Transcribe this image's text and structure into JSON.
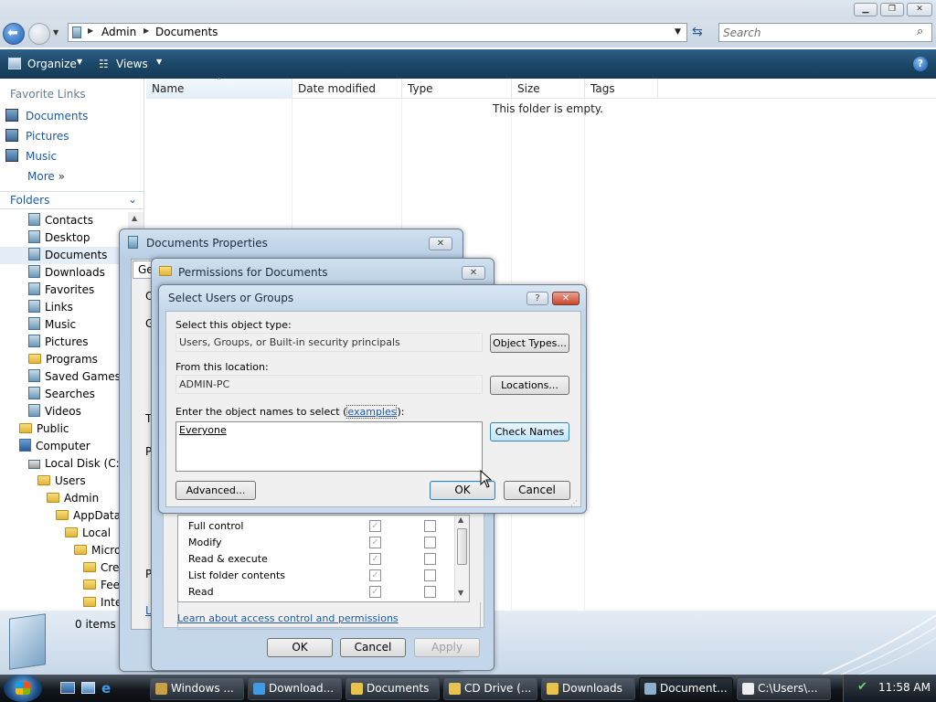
{
  "window": {
    "breadcrumb": [
      "Admin",
      "Documents"
    ],
    "search_placeholder": "Search",
    "caption_buttons": [
      "minimize",
      "maximize",
      "close"
    ]
  },
  "toolbar": {
    "organize": "Organize",
    "views": "Views"
  },
  "nav": {
    "favorite_links_header": "Favorite Links",
    "favorites": [
      "Documents",
      "Pictures",
      "Music"
    ],
    "more": "More",
    "folders_header": "Folders",
    "tree": [
      {
        "label": "Contacts",
        "depth": 2,
        "icon": "doc"
      },
      {
        "label": "Desktop",
        "depth": 2,
        "icon": "doc"
      },
      {
        "label": "Documents",
        "depth": 2,
        "icon": "doc",
        "selected": true
      },
      {
        "label": "Downloads",
        "depth": 2,
        "icon": "doc"
      },
      {
        "label": "Favorites",
        "depth": 2,
        "icon": "doc"
      },
      {
        "label": "Links",
        "depth": 2,
        "icon": "doc"
      },
      {
        "label": "Music",
        "depth": 2,
        "icon": "doc"
      },
      {
        "label": "Pictures",
        "depth": 2,
        "icon": "doc"
      },
      {
        "label": "Programs",
        "depth": 2,
        "icon": "folder"
      },
      {
        "label": "Saved Games",
        "depth": 2,
        "icon": "doc"
      },
      {
        "label": "Searches",
        "depth": 2,
        "icon": "doc"
      },
      {
        "label": "Videos",
        "depth": 2,
        "icon": "doc"
      },
      {
        "label": "Public",
        "depth": 1,
        "icon": "folder"
      },
      {
        "label": "Computer",
        "depth": 1,
        "icon": "computer"
      },
      {
        "label": "Local Disk (C:)",
        "depth": 2,
        "icon": "drive"
      },
      {
        "label": "Users",
        "depth": 3,
        "icon": "folder"
      },
      {
        "label": "Admin",
        "depth": 4,
        "icon": "folder"
      },
      {
        "label": "AppData",
        "depth": 5,
        "icon": "folder"
      },
      {
        "label": "Local",
        "depth": 6,
        "icon": "folder"
      },
      {
        "label": "Micro",
        "depth": 7,
        "icon": "folder"
      },
      {
        "label": "Cre",
        "depth": 8,
        "icon": "folder"
      },
      {
        "label": "Fee",
        "depth": 8,
        "icon": "folder"
      },
      {
        "label": "Inte",
        "depth": 8,
        "icon": "folder"
      }
    ]
  },
  "list": {
    "columns": [
      "Name",
      "Date modified",
      "Type",
      "Size",
      "Tags"
    ],
    "empty_message": "This folder is empty."
  },
  "details": {
    "item_count": "0 items"
  },
  "props_dialog": {
    "title": "Documents Properties",
    "tab_peek": "Ge",
    "peek_letters": [
      "O",
      "G",
      "T",
      "P",
      "P",
      "L"
    ]
  },
  "perm_dialog": {
    "title": "Permissions for Documents",
    "permissions": [
      {
        "name": "Full control"
      },
      {
        "name": "Modify"
      },
      {
        "name": "Read & execute"
      },
      {
        "name": "List folder contents"
      },
      {
        "name": "Read"
      }
    ],
    "learn_link": "Learn about access control and permissions",
    "ok": "OK",
    "cancel": "Cancel",
    "apply": "Apply"
  },
  "select_dialog": {
    "title": "Select Users or Groups",
    "object_type_label": "Select this object type:",
    "object_type_value": "Users, Groups, or Built-in security principals",
    "object_types_btn": "Object Types...",
    "location_label": "From this location:",
    "location_value": "ADMIN-PC",
    "locations_btn": "Locations...",
    "names_label_pre": "Enter the object names to select (",
    "names_label_link": "examples",
    "names_label_post": "):",
    "names_value": "Everyone",
    "check_names_btn": "Check Names",
    "advanced_btn": "Advanced...",
    "ok": "OK",
    "cancel": "Cancel",
    "help_btn": "?"
  },
  "taskbar": {
    "items": [
      {
        "label": "Windows ...",
        "icon": "tools-icon",
        "active": false
      },
      {
        "label": "Download...",
        "icon": "ie-icon",
        "active": false
      },
      {
        "label": "Documents",
        "icon": "folder-icon",
        "active": false
      },
      {
        "label": "CD Drive (...",
        "icon": "folder-icon",
        "active": false
      },
      {
        "label": "Downloads",
        "icon": "folder-icon",
        "active": false
      },
      {
        "label": "Document...",
        "icon": "properties-icon",
        "active": true
      },
      {
        "label": "C:\\Users\\...",
        "icon": "7zip-icon",
        "active": false
      }
    ],
    "clock": "11:58 AM"
  }
}
